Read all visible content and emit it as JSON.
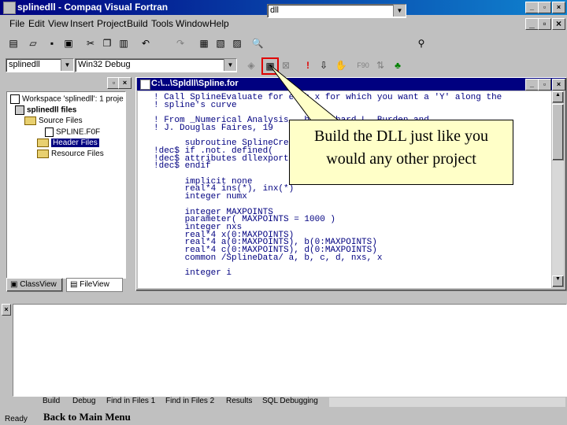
{
  "window": {
    "title": "splinedll - Compaq Visual Fortran"
  },
  "menu": [
    "File",
    "Edit",
    "View",
    "Insert",
    "Project",
    "Build",
    "Tools",
    "Window",
    "Help"
  ],
  "toolbar": {
    "find_value": "dll",
    "config_project": "splinedll",
    "config_build": "Win32 Debug"
  },
  "workspace": {
    "tree": [
      {
        "label": "Workspace 'splinedll': 1 proje"
      },
      {
        "label": "splinedll files"
      },
      {
        "label": "Source Files"
      },
      {
        "label": "SPLINE.F0F"
      },
      {
        "label": "Header Files"
      },
      {
        "label": "Resource Files"
      }
    ],
    "tabs": [
      "ClassView",
      "FileView"
    ]
  },
  "editor": {
    "title": "C:\\...\\Spldll\\Spline.for",
    "lines": [
      "! Call SplineEvaluate for each x for which you want a 'Y' along the",
      "! spline's curve",
      "",
      "! From _Numerical Analysis_, by Richard L. Burden and",
      "! J. Douglas Faires, 19",
      "",
      "      subroutine SplineCreate",
      "!dec$ if .not. defined(",
      "!dec$ attributes dllexport :: SplineCreate",
      "!dec$ endif",
      "",
      "      implicit none",
      "      real*4 ins(*), inx(*)",
      "      integer numx",
      "",
      "      integer MAXPOINTS",
      "      parameter( MAXPOINTS = 1000 )",
      "      integer nxs",
      "      real*4 x(0:MAXPOINTS)",
      "      real*4 a(0:MAXPOINTS), b(0:MAXPOINTS)",
      "      real*4 c(0:MAXPOINTS), d(0:MAXPOINTS)",
      "      common /SplineData/ a, b, c, d, nxs, x",
      "",
      "      integer i"
    ]
  },
  "callout": {
    "line1": "Build the DLL just like you",
    "line2": "would any other project"
  },
  "output": {
    "tabs": [
      "Build",
      "Debug",
      "Find in Files 1",
      "Find in Files 2",
      "Results",
      "SQL Debugging"
    ]
  },
  "status": {
    "text": "Ready",
    "link": "Back to Main Menu"
  }
}
